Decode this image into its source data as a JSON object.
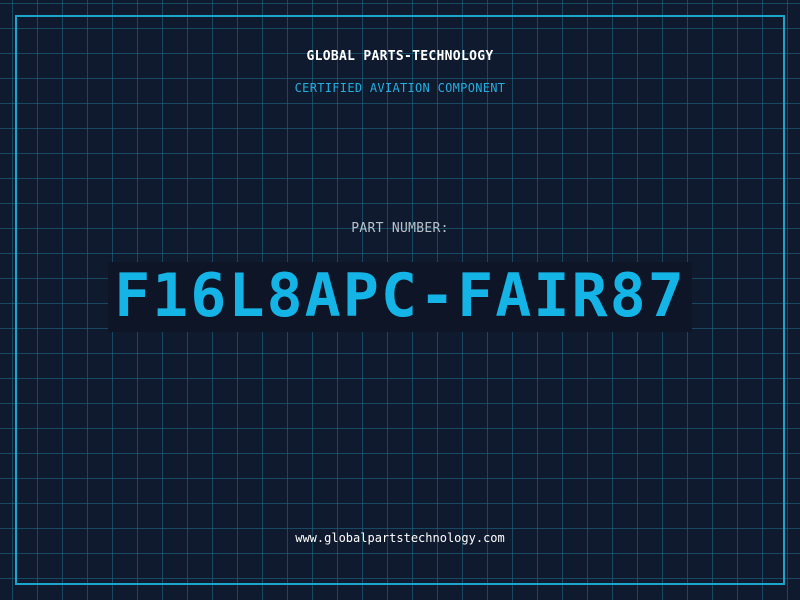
{
  "header": {
    "company": "GLOBAL PARTS-TECHNOLOGY",
    "subtitle": "CERTIFIED AVIATION COMPONENT"
  },
  "part": {
    "label": "PART NUMBER:",
    "number": "F16L8APC-FAIR87"
  },
  "footer": {
    "url": "www.globalpartstechnology.com"
  },
  "colors": {
    "background": "#101a2f",
    "grid": "#1e6e8c",
    "accent": "#14b4e6",
    "frame": "#1aa6cc"
  }
}
